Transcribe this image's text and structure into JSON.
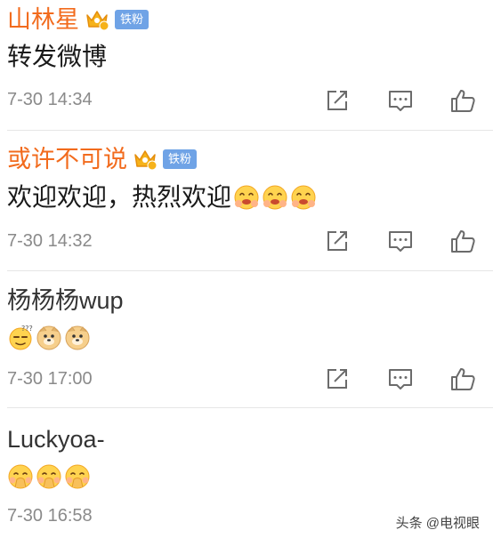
{
  "colors": {
    "vip_name": "#f26b1d",
    "plain_name": "#333333",
    "badge_bg": "#6fa3e6",
    "time": "#8a8a8a",
    "icon": "#6b6b6b"
  },
  "comments": [
    {
      "username": "山林星",
      "badge": "铁粉",
      "vip_level": "6",
      "text": "转发微博",
      "emojis": [],
      "time": "7-30 14:34"
    },
    {
      "username": "或许不可说",
      "badge": "铁粉",
      "vip_level": "4",
      "text": "欢迎欢迎，热烈欢迎",
      "emojis": [
        "blush-emoji",
        "blush-emoji",
        "blush-emoji"
      ],
      "time": "7-30 14:32"
    },
    {
      "username": "杨杨杨wup",
      "badge": "",
      "text": "",
      "emojis": [
        "confused-emoji",
        "doge-emoji",
        "doge-emoji"
      ],
      "time": "7-30 17:00"
    },
    {
      "username": "Luckyoa-",
      "badge": "",
      "text": "",
      "emojis": [
        "hush-emoji",
        "hush-emoji",
        "hush-emoji"
      ],
      "time": "7-30 16:58"
    }
  ],
  "actions": {
    "repost": "repost-icon",
    "reply": "comment-icon",
    "like": "like-icon"
  },
  "watermark": "头条 @电视眼"
}
